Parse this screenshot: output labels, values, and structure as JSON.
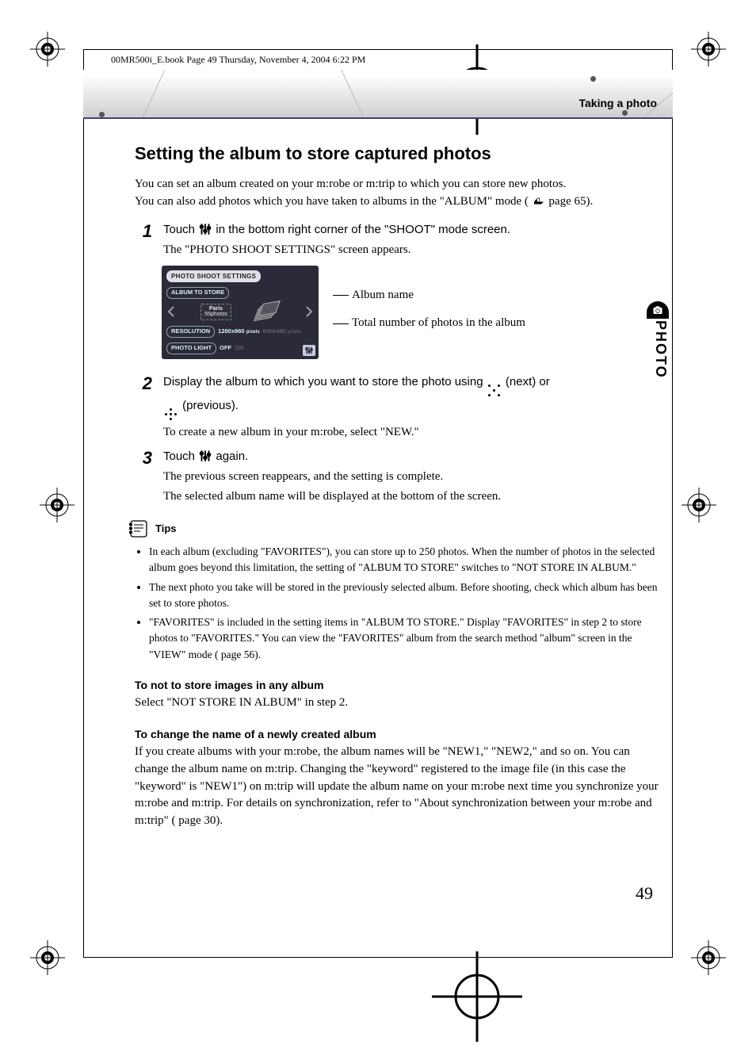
{
  "bookline": "00MR500i_E.book  Page 49  Thursday, November 4, 2004  6:22 PM",
  "header_section": "Taking a photo",
  "side_tab": "PHOTO",
  "title": "Setting the album to store captured photos",
  "intro_1": "You can set an album created on your m:robe or m:trip to which you can store new photos.",
  "intro_2a": "You can also add photos which you have taken to albums in the \"ALBUM\" mode (",
  "intro_2b": "page 65).",
  "steps": {
    "1": {
      "lead_a": "Touch ",
      "lead_b": " in the bottom right corner of the \"SHOOT\" mode screen.",
      "note": "The \"PHOTO SHOOT SETTINGS\" screen appears."
    },
    "2": {
      "lead_a": "Display the album to which you want to store the photo using ",
      "lead_mid": "(next) or ",
      "lead_b": "(previous).",
      "note": "To create a new album in your m:robe, select \"NEW.\""
    },
    "3": {
      "lead_a": "Touch ",
      "lead_b": " again.",
      "note1": "The previous screen reappears, and the setting is complete.",
      "note2": "The selected album name will be displayed at the bottom of the screen."
    }
  },
  "device": {
    "title": "PHOTO SHOOT SETTINGS",
    "album_label": "ALBUM TO STORE",
    "album_name": "Paris",
    "album_count": "55photos",
    "resolution_label": "RESOLUTION",
    "resolution_opt1": "1280x960",
    "resolution_unit": "pixels",
    "resolution_opt2": "640x480",
    "light_label": "PHOTO LIGHT",
    "light_off": "OFF",
    "light_on": "ON"
  },
  "callouts": {
    "album_name": "Album name",
    "total": "Total number of photos in the album"
  },
  "tips_label": "Tips",
  "tips": [
    "In each album (excluding \"FAVORITES\"), you can store up to 250 photos. When the number of photos in the selected album goes beyond this limitation, the setting of \"ALBUM TO STORE\" switches to \"NOT STORE IN ALBUM.\"",
    "The next photo you take will be stored in the previously selected album. Before shooting, check which album has been set to store photos.",
    "\"FAVORITES\" is included in the setting items in \"ALBUM TO STORE.\" Display \"FAVORITES\" in step 2 to store photos to \"FAVORITES.\" You can view the \"FAVORITES\" album from the search method \"album\" screen in the \"VIEW\" mode (        page 56)."
  ],
  "sub1_head": "To not to store images in any album",
  "sub1_text": "Select \"NOT STORE IN ALBUM\" in step 2.",
  "sub2_head": "To change the name of a newly created album",
  "sub2_text": "If you create albums with your m:robe, the album names will be \"NEW1,\" \"NEW2,\" and so on. You can change the album name on m:trip. Changing the \"keyword\" registered to the image file (in this case the \"keyword\" is \"NEW1\") on m:trip will update the album name on your m:robe next time you synchronize your m:robe and m:trip. For details on synchronization, refer to \"About synchronization between your m:robe and m:trip\" (        page 30).",
  "page_number": "49"
}
